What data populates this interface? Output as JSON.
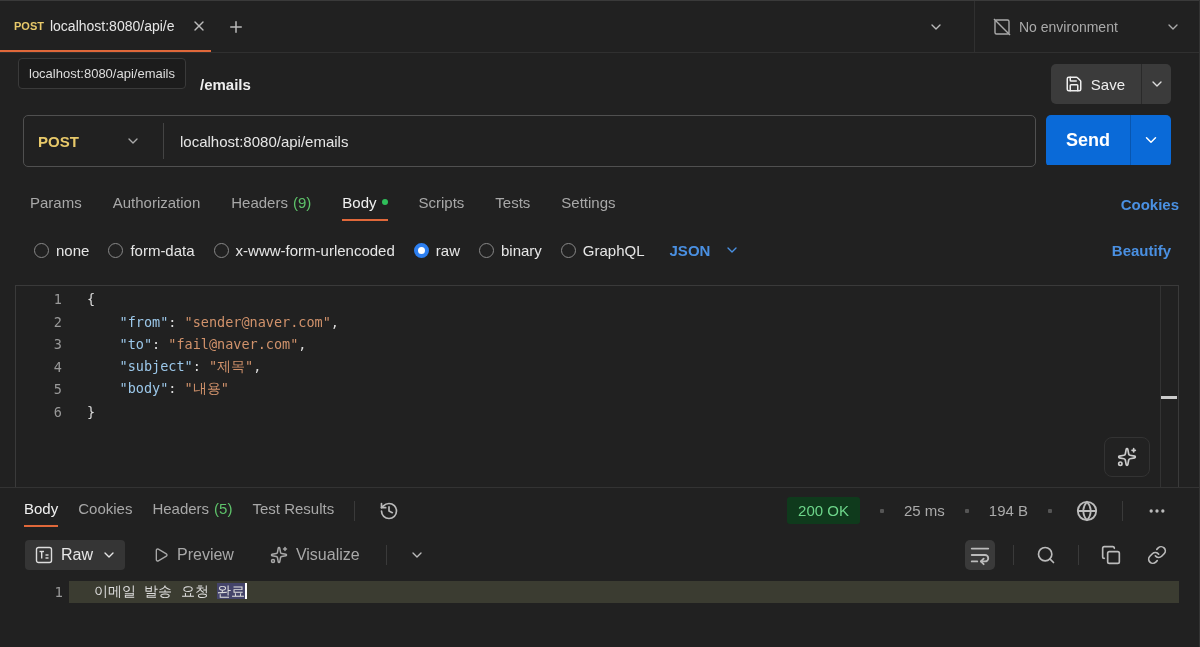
{
  "request_tabs": [
    {
      "method": "POST",
      "label": "localhost:8080/api/e",
      "selected": true
    }
  ],
  "environment": {
    "label": "No environment"
  },
  "tooltip": "localhost:8080/api/emails",
  "request_name": "/emails",
  "save_button": "Save",
  "url_bar": {
    "method": "POST",
    "value": "localhost:8080/api/emails"
  },
  "send_button": "Send",
  "section_tabs": [
    {
      "label": "Params",
      "selected": false,
      "modified": false
    },
    {
      "label": "Authorization",
      "selected": false,
      "modified": false
    },
    {
      "label": "Headers",
      "count": "(9)",
      "selected": false,
      "modified": false
    },
    {
      "label": "Body",
      "selected": true,
      "modified": true
    },
    {
      "label": "Scripts",
      "selected": false,
      "modified": false
    },
    {
      "label": "Tests",
      "selected": false,
      "modified": false
    },
    {
      "label": "Settings",
      "selected": false,
      "modified": false
    }
  ],
  "cookies_link": "Cookies",
  "body_types": [
    {
      "label": "none",
      "selected": false
    },
    {
      "label": "form-data",
      "selected": false
    },
    {
      "label": "x-www-form-urlencoded",
      "selected": false
    },
    {
      "label": "raw",
      "selected": true
    },
    {
      "label": "binary",
      "selected": false
    },
    {
      "label": "GraphQL",
      "selected": false
    }
  ],
  "format_dropdown": "JSON",
  "beautify_link": "Beautify",
  "editor_lines": [
    {
      "number": "1",
      "tokens": [
        {
          "kind": "punct",
          "text": "{"
        }
      ]
    },
    {
      "number": "2",
      "tokens": [
        {
          "kind": "key",
          "text": "    \"from\""
        },
        {
          "kind": "punct",
          "text": ": "
        },
        {
          "kind": "string",
          "text": "\"sender@naver.com\""
        },
        {
          "kind": "punct",
          "text": ","
        }
      ]
    },
    {
      "number": "3",
      "tokens": [
        {
          "kind": "key",
          "text": "    \"to\""
        },
        {
          "kind": "punct",
          "text": ": "
        },
        {
          "kind": "string",
          "text": "\"fail@naver.com\""
        },
        {
          "kind": "punct",
          "text": ","
        }
      ]
    },
    {
      "number": "4",
      "tokens": [
        {
          "kind": "key",
          "text": "    \"subject\""
        },
        {
          "kind": "punct",
          "text": ": "
        },
        {
          "kind": "string",
          "text": "\"제목\""
        },
        {
          "kind": "punct",
          "text": ","
        }
      ]
    },
    {
      "number": "5",
      "tokens": [
        {
          "kind": "key",
          "text": "    \"body\""
        },
        {
          "kind": "punct",
          "text": ": "
        },
        {
          "kind": "string",
          "text": "\"내용\""
        }
      ]
    },
    {
      "number": "6",
      "tokens": [
        {
          "kind": "punct",
          "text": "}"
        }
      ]
    }
  ],
  "response_tabs": [
    {
      "label": "Body",
      "selected": true
    },
    {
      "label": "Cookies",
      "selected": false
    },
    {
      "label": "Headers",
      "count": "(5)",
      "selected": false
    },
    {
      "label": "Test Results",
      "selected": false
    }
  ],
  "response_status": {
    "status": "200 OK",
    "time": "25 ms",
    "size": "194 B"
  },
  "response_views": [
    {
      "label": "Raw",
      "selected": true
    },
    {
      "label": "Preview",
      "selected": false
    },
    {
      "label": "Visualize",
      "selected": false
    }
  ],
  "wrap_lines_active": true,
  "response_lines": [
    {
      "number": "1",
      "text": "이메일 발송 요청 ",
      "selection": "완료"
    }
  ]
}
